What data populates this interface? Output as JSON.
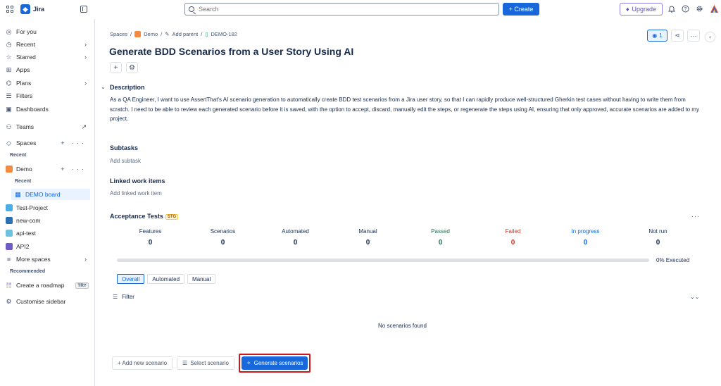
{
  "topbar": {
    "app_title": "Jira",
    "search_placeholder": "Search",
    "create_label": "+ Create",
    "upgrade_label": "Upgrade",
    "icons": [
      "grid-icon",
      "sidebar-collapse-icon",
      "bell-icon",
      "help-icon",
      "settings-icon",
      "avatar"
    ]
  },
  "sidebar": {
    "for_you": "For you",
    "recent": "Recent",
    "starred": "Starred",
    "apps": "Apps",
    "plans": "Plans",
    "filters": "Filters",
    "dashboards": "Dashboards",
    "teams": "Teams",
    "spaces": "Spaces",
    "recent_head": "Recent",
    "demo": "Demo",
    "demo_recent_head": "Recent",
    "demo_board": "DEMO board",
    "test_project": "Test-Project",
    "new_com": "new-com",
    "api_test": "api-test",
    "api2": "API2",
    "more_spaces": "More spaces",
    "recommended_head": "Recommended",
    "create_roadmap": "Create a roadmap",
    "try_badge": "TRY",
    "customise": "Customise sidebar"
  },
  "breadcrumb": {
    "spaces": "Spaces",
    "demo": "Demo",
    "add_parent": "Add parent",
    "issue_key": "DEMO-182"
  },
  "header": {
    "watch_count": "1",
    "title": "Generate BDD Scenarios from a User Story Using AI"
  },
  "description": {
    "heading": "Description",
    "text": "As a QA Engineer, I want to use AssertThat's AI scenario generation to automatically create BDD test scenarios from a Jira user story, so that I can rapidly produce well-structured Gherkin test cases without having to write them from scratch. I need to be able to review each generated scenario before it is saved, with the option to accept, discard, manually edit the steps, or regenerate the steps using AI, ensuring that only approved, accurate scenarios are added to my project."
  },
  "subtasks": {
    "heading": "Subtasks",
    "placeholder": "Add subtask"
  },
  "linked": {
    "heading": "Linked work items",
    "placeholder": "Add linked work item"
  },
  "acceptance": {
    "heading": "Acceptance Tests",
    "badge": "STG",
    "stats": [
      {
        "label": "Features",
        "value": "0",
        "color": "#172b4d"
      },
      {
        "label": "Scenarios",
        "value": "0",
        "color": "#172b4d"
      },
      {
        "label": "Automated",
        "value": "0",
        "color": "#172b4d"
      },
      {
        "label": "Manual",
        "value": "0",
        "color": "#172b4d"
      },
      {
        "label": "Passed",
        "value": "0",
        "color": "#216e4e"
      },
      {
        "label": "Failed",
        "value": "0",
        "color": "#c9372c"
      },
      {
        "label": "In progress",
        "value": "0",
        "color": "#0c66e4"
      },
      {
        "label": "Not run",
        "value": "0",
        "color": "#172b4d"
      }
    ],
    "executed_fraction": 0,
    "executed_label": "0% Executed",
    "tabs": [
      "Overall",
      "Automated",
      "Manual"
    ],
    "active_tab": "Overall",
    "filter_label": "Filter",
    "empty_text": "No scenarios found",
    "add_new": "+ Add new scenario",
    "select": "Select scenario",
    "generate": "Generate scenarios"
  },
  "colors": {
    "accent": "#1868db",
    "highlight_border": "#d0171e"
  }
}
